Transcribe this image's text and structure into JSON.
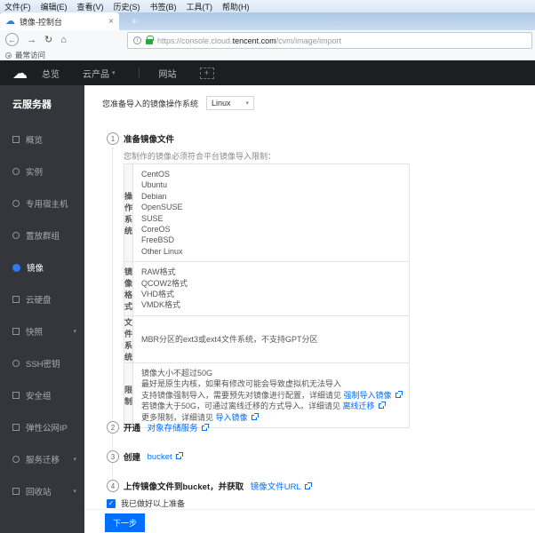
{
  "colors": {
    "accent": "#006eff",
    "link": "#006eff",
    "lock_green": "#27a83c",
    "sidebar_bg": "#35363b",
    "topnav_bg": "#1c1e22"
  },
  "icons": {
    "back": "←",
    "forward": "→",
    "refresh": "↻",
    "home": "⌂",
    "new_tab": "+",
    "tab_close": "×",
    "favicon_cloud": "☁",
    "cloud_logo": "☁",
    "caret_down": "▾",
    "plus_shortcut": "+",
    "info": "i",
    "check": "✓"
  },
  "browser": {
    "menu_items": [
      "文件(F)",
      "编辑(E)",
      "查看(V)",
      "历史(S)",
      "书签(B)",
      "工具(T)",
      "帮助(H)"
    ],
    "tab_title": "镜像-控制台",
    "url": {
      "prefix": "https://console.cloud.",
      "domain": "tencent.com",
      "path": "/cvm/image/import"
    },
    "bookmarks": {
      "most_visited": "最常访问"
    }
  },
  "console_nav": {
    "overview": "总览",
    "cloud_products": "云产品",
    "website": "网站"
  },
  "sidebar": {
    "title": "云服务器",
    "items": [
      {
        "label": "概览",
        "icon": "overview-icon",
        "shape": "square",
        "active": false,
        "expandable": false
      },
      {
        "label": "实例",
        "icon": "instance-icon",
        "shape": "round",
        "active": false,
        "expandable": false
      },
      {
        "label": "专用宿主机",
        "icon": "dedicated-host-icon",
        "shape": "round",
        "active": false,
        "expandable": false
      },
      {
        "label": "置放群组",
        "icon": "placement-group-icon",
        "shape": "round",
        "active": false,
        "expandable": false
      },
      {
        "label": "镜像",
        "icon": "image-icon",
        "shape": "round",
        "active": true,
        "expandable": false
      },
      {
        "label": "云硬盘",
        "icon": "cloud-disk-icon",
        "shape": "square",
        "active": false,
        "expandable": false
      },
      {
        "label": "快照",
        "icon": "snapshot-icon",
        "shape": "square",
        "active": false,
        "expandable": true
      },
      {
        "label": "SSH密钥",
        "icon": "ssh-key-icon",
        "shape": "round",
        "active": false,
        "expandable": false
      },
      {
        "label": "安全组",
        "icon": "security-group-icon",
        "shape": "square",
        "active": false,
        "expandable": false
      },
      {
        "label": "弹性公网IP",
        "icon": "eip-icon",
        "shape": "square",
        "active": false,
        "expandable": false
      },
      {
        "label": "服务迁移",
        "icon": "migration-icon",
        "shape": "round",
        "active": false,
        "expandable": true
      },
      {
        "label": "回收站",
        "icon": "recycle-bin-icon",
        "shape": "square",
        "active": false,
        "expandable": true
      }
    ]
  },
  "main": {
    "os_select": {
      "label": "您准备导入的镜像操作系统",
      "value": "Linux"
    },
    "steps": [
      {
        "num": "1",
        "title": "准备镜像文件",
        "desc": "您制作的镜像必须符合平台镜像导入限制："
      },
      {
        "num": "2",
        "prefix": "开通 ",
        "link": "对象存储服务"
      },
      {
        "num": "3",
        "prefix": "创建 ",
        "link": "bucket"
      },
      {
        "num": "4",
        "prefix": "上传镜像文件到bucket，并获取 ",
        "link": "镜像文件URL"
      }
    ],
    "table": {
      "rows": [
        {
          "label": "操作系统",
          "lines": [
            [
              {
                "t": "CentOS"
              }
            ],
            [
              {
                "t": "Ubuntu"
              }
            ],
            [
              {
                "t": "Debian"
              }
            ],
            [
              {
                "t": "OpenSUSE"
              }
            ],
            [
              {
                "t": "SUSE"
              }
            ],
            [
              {
                "t": "CoreOS"
              }
            ],
            [
              {
                "t": "FreeBSD"
              }
            ],
            [
              {
                "t": "Other Linux"
              }
            ]
          ]
        },
        {
          "label": "镜像格式",
          "lines": [
            [
              {
                "t": "RAW格式"
              }
            ],
            [
              {
                "t": "QCOW2格式"
              }
            ],
            [
              {
                "t": "VHD格式"
              }
            ],
            [
              {
                "t": "VMDK格式"
              }
            ]
          ]
        },
        {
          "label": "文件系统",
          "lines": [
            [
              {
                "t": "MBR分区的ext3或ext4文件系统，不支持GPT分区"
              }
            ]
          ]
        },
        {
          "label": "限制",
          "lines": [
            [
              {
                "t": "镜像大小不超过50G"
              }
            ],
            [
              {
                "t": "最好是原生内核，如果有修改可能会导致虚拟机无法导入"
              }
            ],
            [
              {
                "t": "支持镜像强制导入，需要预先对镜像进行配置，详细请见 "
              },
              {
                "t": "强制导入镜像",
                "link": true
              }
            ],
            [
              {
                "t": "若镜像大于50G，可通过离线迁移的方式导入。详细请见 "
              },
              {
                "t": "离线迁移",
                "link": true
              }
            ],
            [
              {
                "t": "更多限制，详细请见 "
              },
              {
                "t": "导入镜像",
                "link": true
              }
            ]
          ]
        }
      ]
    },
    "checkbox_label": "我已做好以上准备",
    "next_button": "下一步"
  }
}
